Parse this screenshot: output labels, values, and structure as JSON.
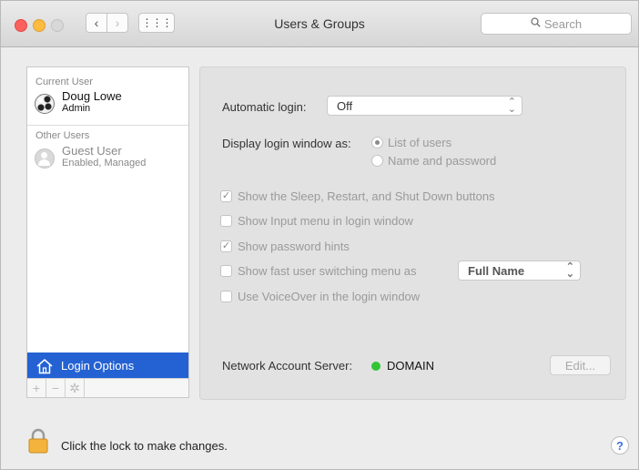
{
  "window": {
    "title": "Users & Groups"
  },
  "toolbar": {
    "back_glyph": "‹",
    "forward_glyph": "›",
    "grid_glyph": "⋮⋮⋮",
    "search_placeholder": "Search"
  },
  "sidebar": {
    "current_user_heading": "Current User",
    "current_user": {
      "name": "Doug Lowe",
      "role": "Admin"
    },
    "other_users_heading": "Other Users",
    "other_users": [
      {
        "name": "Guest User",
        "role": "Enabled, Managed"
      }
    ],
    "login_options_label": "Login Options",
    "add_glyph": "+",
    "remove_glyph": "−",
    "action_glyph": "✲"
  },
  "main": {
    "automatic_login": {
      "label": "Automatic login:",
      "value": "Off"
    },
    "display_login": {
      "label": "Display login window as:",
      "options": [
        {
          "label": "List of users",
          "selected": true
        },
        {
          "label": "Name and password",
          "selected": false
        }
      ]
    },
    "checkboxes": [
      {
        "label": "Show the Sleep, Restart, and Shut Down buttons",
        "checked": true
      },
      {
        "label": "Show Input menu in login window",
        "checked": false
      },
      {
        "label": "Show password hints",
        "checked": true
      },
      {
        "label": "Show fast user switching menu as",
        "checked": false
      },
      {
        "label": "Use VoiceOver in the login window",
        "checked": false
      }
    ],
    "fast_switch_value": "Full Name",
    "network_account": {
      "label": "Network Account Server:",
      "value": "DOMAIN",
      "status_color": "#30c536"
    },
    "edit_button_label": "Edit..."
  },
  "footer": {
    "lock_text": "Click the lock to make changes.",
    "help_glyph": "?"
  },
  "colors": {
    "selection": "#2462d3",
    "close": "#fc605c",
    "minimize": "#fdbc40"
  }
}
